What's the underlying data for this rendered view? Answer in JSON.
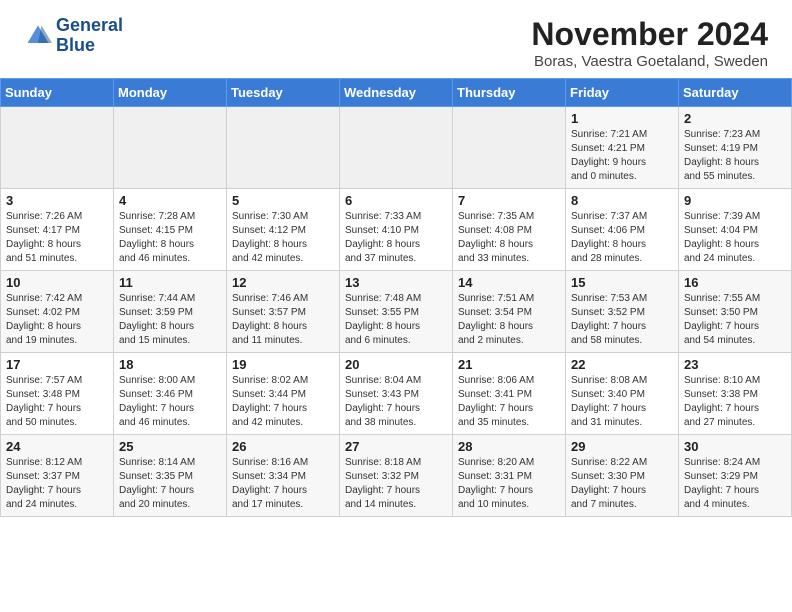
{
  "logo": {
    "line1": "General",
    "line2": "Blue"
  },
  "title": "November 2024",
  "location": "Boras, Vaestra Goetaland, Sweden",
  "weekdays": [
    "Sunday",
    "Monday",
    "Tuesday",
    "Wednesday",
    "Thursday",
    "Friday",
    "Saturday"
  ],
  "weeks": [
    [
      {
        "day": "",
        "info": ""
      },
      {
        "day": "",
        "info": ""
      },
      {
        "day": "",
        "info": ""
      },
      {
        "day": "",
        "info": ""
      },
      {
        "day": "",
        "info": ""
      },
      {
        "day": "1",
        "info": "Sunrise: 7:21 AM\nSunset: 4:21 PM\nDaylight: 9 hours\nand 0 minutes."
      },
      {
        "day": "2",
        "info": "Sunrise: 7:23 AM\nSunset: 4:19 PM\nDaylight: 8 hours\nand 55 minutes."
      }
    ],
    [
      {
        "day": "3",
        "info": "Sunrise: 7:26 AM\nSunset: 4:17 PM\nDaylight: 8 hours\nand 51 minutes."
      },
      {
        "day": "4",
        "info": "Sunrise: 7:28 AM\nSunset: 4:15 PM\nDaylight: 8 hours\nand 46 minutes."
      },
      {
        "day": "5",
        "info": "Sunrise: 7:30 AM\nSunset: 4:12 PM\nDaylight: 8 hours\nand 42 minutes."
      },
      {
        "day": "6",
        "info": "Sunrise: 7:33 AM\nSunset: 4:10 PM\nDaylight: 8 hours\nand 37 minutes."
      },
      {
        "day": "7",
        "info": "Sunrise: 7:35 AM\nSunset: 4:08 PM\nDaylight: 8 hours\nand 33 minutes."
      },
      {
        "day": "8",
        "info": "Sunrise: 7:37 AM\nSunset: 4:06 PM\nDaylight: 8 hours\nand 28 minutes."
      },
      {
        "day": "9",
        "info": "Sunrise: 7:39 AM\nSunset: 4:04 PM\nDaylight: 8 hours\nand 24 minutes."
      }
    ],
    [
      {
        "day": "10",
        "info": "Sunrise: 7:42 AM\nSunset: 4:02 PM\nDaylight: 8 hours\nand 19 minutes."
      },
      {
        "day": "11",
        "info": "Sunrise: 7:44 AM\nSunset: 3:59 PM\nDaylight: 8 hours\nand 15 minutes."
      },
      {
        "day": "12",
        "info": "Sunrise: 7:46 AM\nSunset: 3:57 PM\nDaylight: 8 hours\nand 11 minutes."
      },
      {
        "day": "13",
        "info": "Sunrise: 7:48 AM\nSunset: 3:55 PM\nDaylight: 8 hours\nand 6 minutes."
      },
      {
        "day": "14",
        "info": "Sunrise: 7:51 AM\nSunset: 3:54 PM\nDaylight: 8 hours\nand 2 minutes."
      },
      {
        "day": "15",
        "info": "Sunrise: 7:53 AM\nSunset: 3:52 PM\nDaylight: 7 hours\nand 58 minutes."
      },
      {
        "day": "16",
        "info": "Sunrise: 7:55 AM\nSunset: 3:50 PM\nDaylight: 7 hours\nand 54 minutes."
      }
    ],
    [
      {
        "day": "17",
        "info": "Sunrise: 7:57 AM\nSunset: 3:48 PM\nDaylight: 7 hours\nand 50 minutes."
      },
      {
        "day": "18",
        "info": "Sunrise: 8:00 AM\nSunset: 3:46 PM\nDaylight: 7 hours\nand 46 minutes."
      },
      {
        "day": "19",
        "info": "Sunrise: 8:02 AM\nSunset: 3:44 PM\nDaylight: 7 hours\nand 42 minutes."
      },
      {
        "day": "20",
        "info": "Sunrise: 8:04 AM\nSunset: 3:43 PM\nDaylight: 7 hours\nand 38 minutes."
      },
      {
        "day": "21",
        "info": "Sunrise: 8:06 AM\nSunset: 3:41 PM\nDaylight: 7 hours\nand 35 minutes."
      },
      {
        "day": "22",
        "info": "Sunrise: 8:08 AM\nSunset: 3:40 PM\nDaylight: 7 hours\nand 31 minutes."
      },
      {
        "day": "23",
        "info": "Sunrise: 8:10 AM\nSunset: 3:38 PM\nDaylight: 7 hours\nand 27 minutes."
      }
    ],
    [
      {
        "day": "24",
        "info": "Sunrise: 8:12 AM\nSunset: 3:37 PM\nDaylight: 7 hours\nand 24 minutes."
      },
      {
        "day": "25",
        "info": "Sunrise: 8:14 AM\nSunset: 3:35 PM\nDaylight: 7 hours\nand 20 minutes."
      },
      {
        "day": "26",
        "info": "Sunrise: 8:16 AM\nSunset: 3:34 PM\nDaylight: 7 hours\nand 17 minutes."
      },
      {
        "day": "27",
        "info": "Sunrise: 8:18 AM\nSunset: 3:32 PM\nDaylight: 7 hours\nand 14 minutes."
      },
      {
        "day": "28",
        "info": "Sunrise: 8:20 AM\nSunset: 3:31 PM\nDaylight: 7 hours\nand 10 minutes."
      },
      {
        "day": "29",
        "info": "Sunrise: 8:22 AM\nSunset: 3:30 PM\nDaylight: 7 hours\nand 7 minutes."
      },
      {
        "day": "30",
        "info": "Sunrise: 8:24 AM\nSunset: 3:29 PM\nDaylight: 7 hours\nand 4 minutes."
      }
    ]
  ]
}
